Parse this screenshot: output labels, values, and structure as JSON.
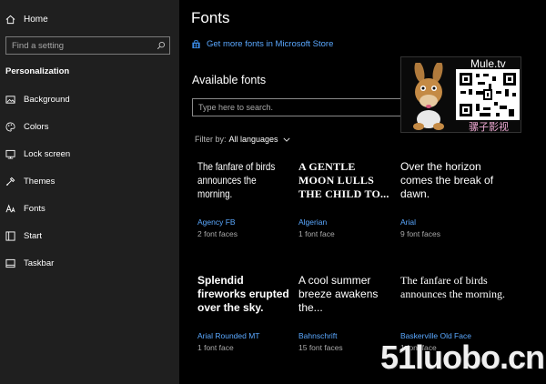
{
  "sidebar": {
    "home_label": "Home",
    "search_placeholder": "Find a setting",
    "section_title": "Personalization",
    "items": [
      {
        "label": "Background",
        "icon": "image-icon"
      },
      {
        "label": "Colors",
        "icon": "palette-icon"
      },
      {
        "label": "Lock screen",
        "icon": "lock-screen-icon"
      },
      {
        "label": "Themes",
        "icon": "themes-icon"
      },
      {
        "label": "Fonts",
        "icon": "fonts-icon"
      },
      {
        "label": "Start",
        "icon": "start-icon"
      },
      {
        "label": "Taskbar",
        "icon": "taskbar-icon"
      }
    ]
  },
  "main": {
    "title": "Fonts",
    "store_link": "Get more fonts in Microsoft Store",
    "available_title": "Available fonts",
    "font_search_placeholder": "Type here to search.",
    "filter_label": "Filter by:",
    "filter_value": "All languages",
    "fonts": [
      {
        "preview": "The fanfare of birds announces the morning.",
        "name": "Agency FB",
        "faces": "2 font faces"
      },
      {
        "preview": "A GENTLE MOON LULLS THE CHILD TO...",
        "name": "Algerian",
        "faces": "1 font face"
      },
      {
        "preview": "Over the horizon comes the break of dawn.",
        "name": "Arial",
        "faces": "9 font faces"
      },
      {
        "preview": "Splendid fireworks erupted over the sky.",
        "name": "Arial Rounded MT",
        "faces": "1 font face"
      },
      {
        "preview": "A cool summer breeze awakens the...",
        "name": "Bahnschrift",
        "faces": "15 font faces"
      },
      {
        "preview": "The fanfare of birds announces the morning.",
        "name": "Baskerville Old Face",
        "faces": "1 font face"
      }
    ]
  },
  "watermarks": {
    "mule_brand": "Mule.tv",
    "mule_zh": "骡子影视",
    "site": "51luobo.cn"
  },
  "colors": {
    "accent": "#5aa8ff",
    "sidebar_bg": "#1f1f1f",
    "main_bg": "#000000"
  }
}
